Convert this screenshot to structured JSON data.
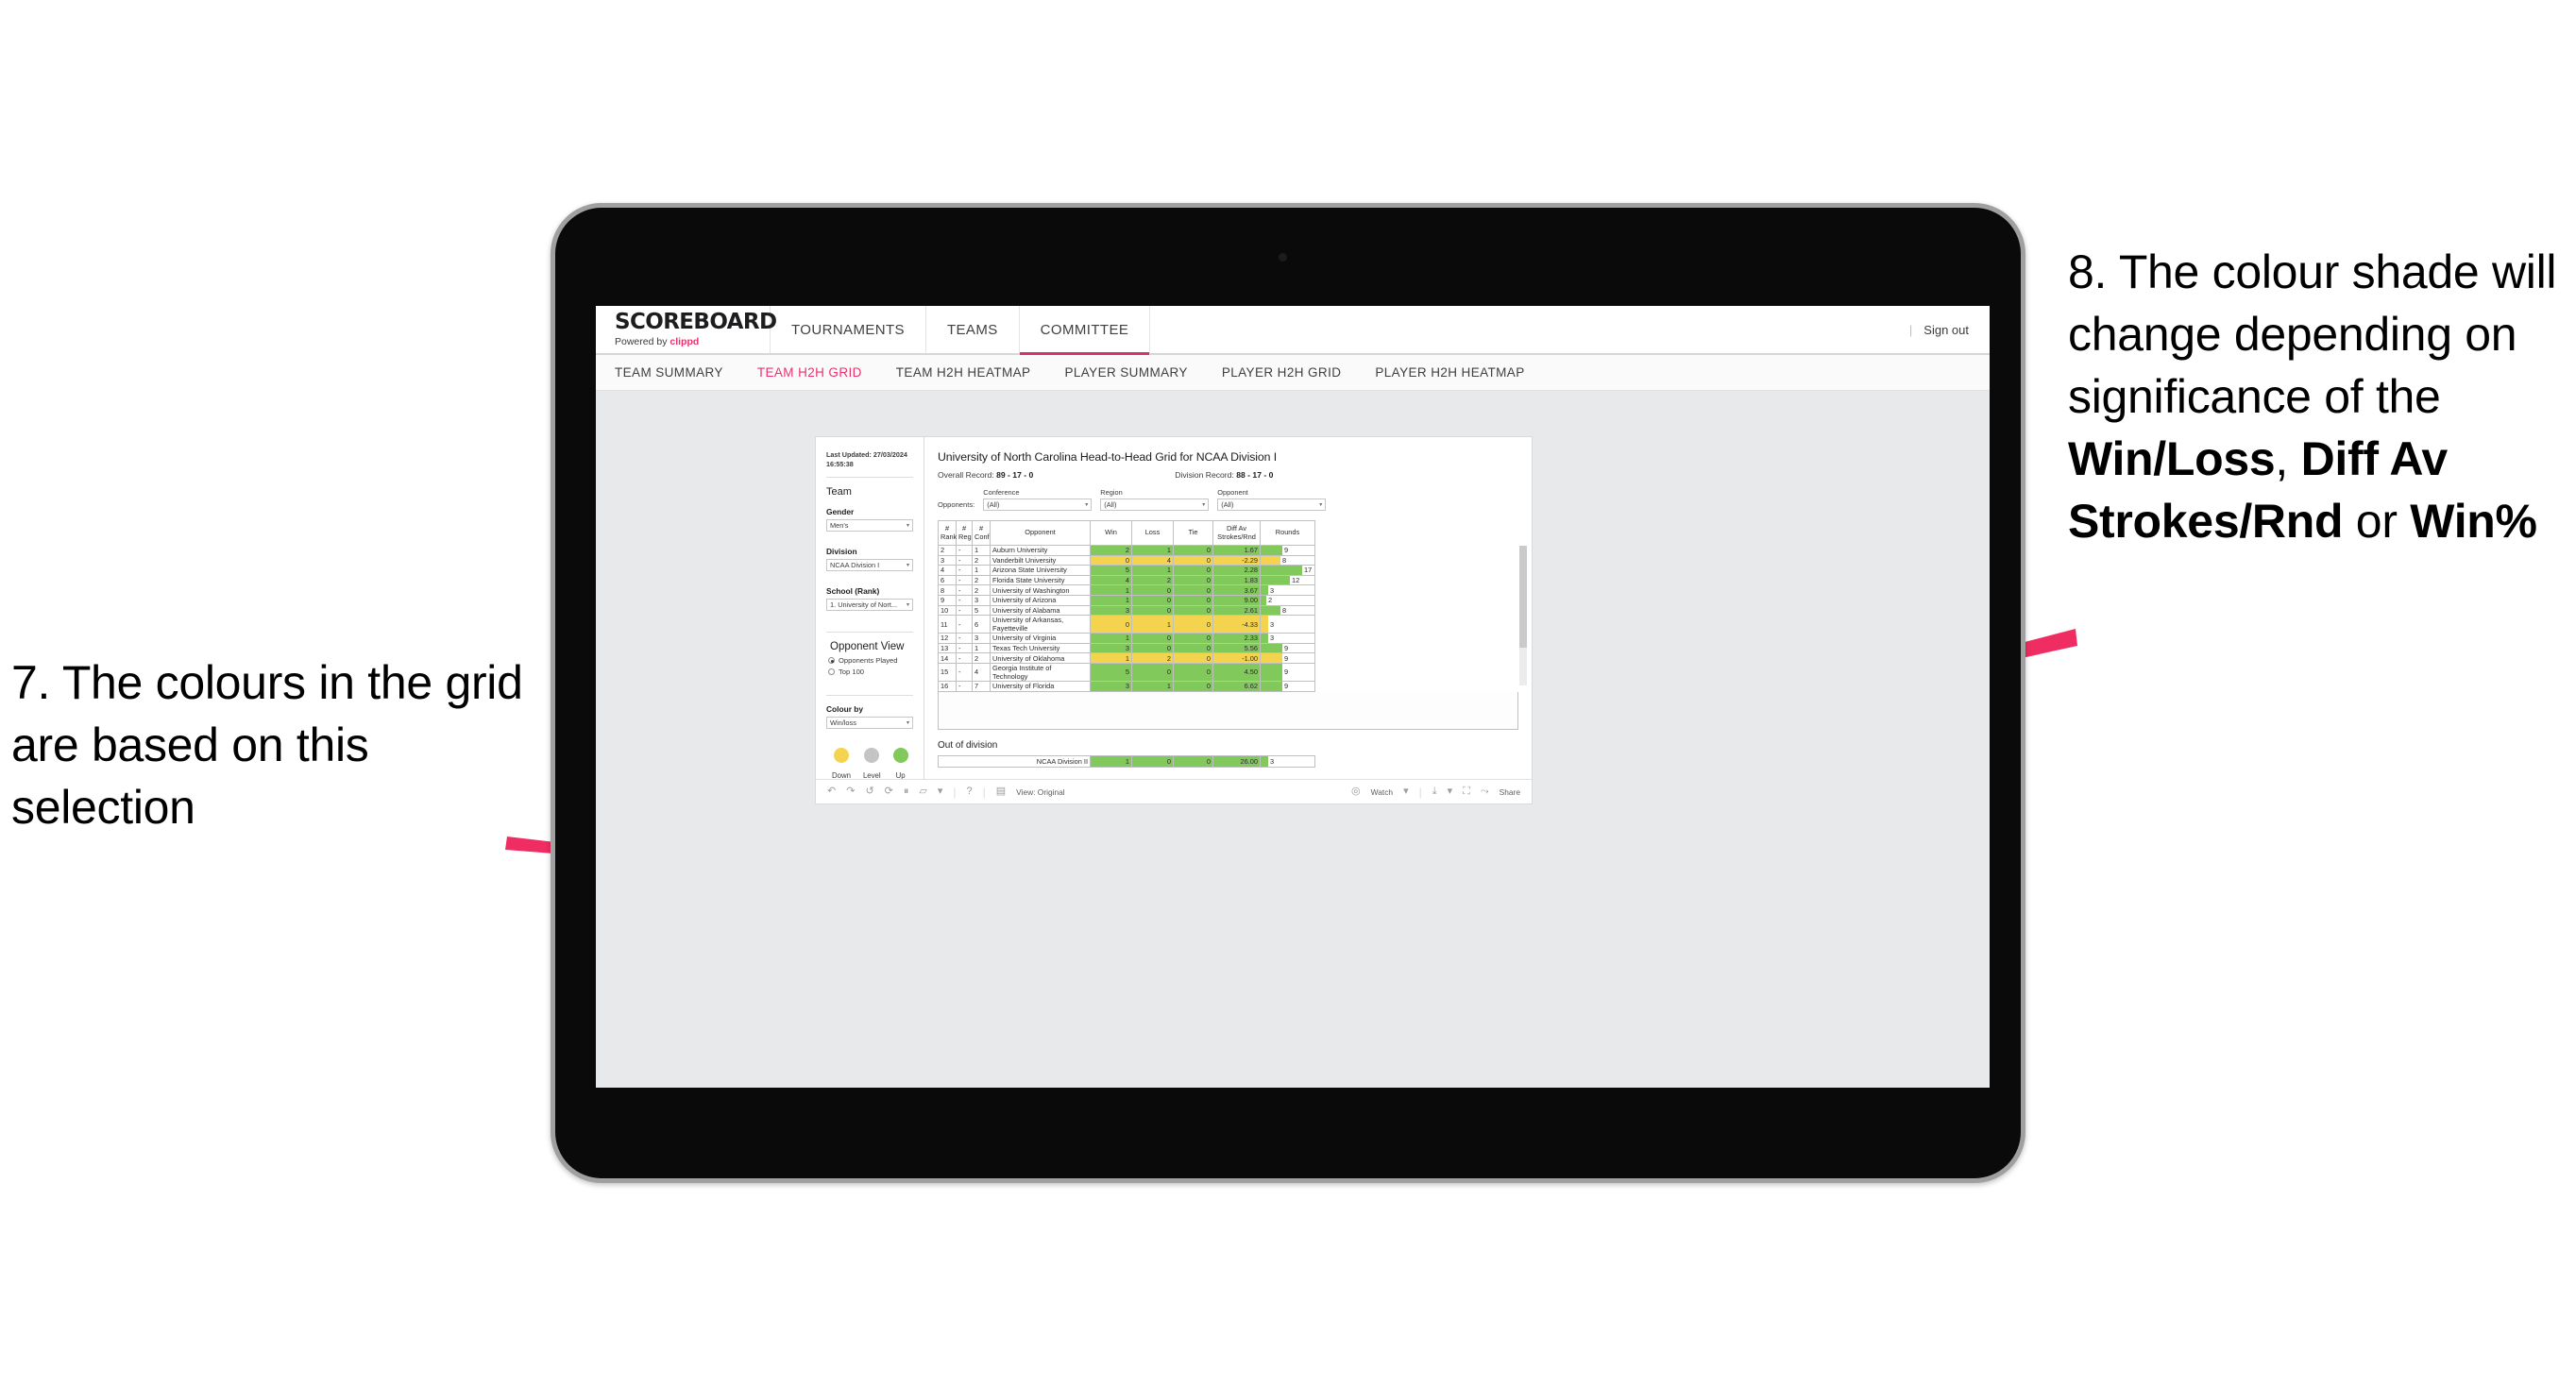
{
  "annotations": {
    "left": {
      "number": "7.",
      "text": "The colours in the grid are based on this selection"
    },
    "right": {
      "number": "8.",
      "part1": "The colour shade will change depending on significance of the ",
      "bold1": "Win/Loss",
      "mid1": ", ",
      "bold2": "Diff Av Strokes/Rnd",
      "mid2": " or ",
      "bold3": "Win%"
    },
    "arrow_color": "#f02d62"
  },
  "app": {
    "brand": {
      "logo": "SCOREBOARD",
      "powered_prefix": "Powered by ",
      "powered_brand": "clippd"
    },
    "topnav": [
      {
        "label": "TOURNAMENTS",
        "active": false
      },
      {
        "label": "TEAMS",
        "active": false
      },
      {
        "label": "COMMITTEE",
        "active": true
      }
    ],
    "account": {
      "divider": "|",
      "sign_out": "Sign out"
    },
    "subnav": [
      {
        "label": "TEAM SUMMARY",
        "active": false
      },
      {
        "label": "TEAM H2H GRID",
        "active": true
      },
      {
        "label": "TEAM H2H HEATMAP",
        "active": false
      },
      {
        "label": "PLAYER SUMMARY",
        "active": false
      },
      {
        "label": "PLAYER H2H GRID",
        "active": false
      },
      {
        "label": "PLAYER H2H HEATMAP",
        "active": false
      }
    ]
  },
  "pane": {
    "last_updated": "Last Updated: 27/03/2024 16:55:38",
    "team_heading": "Team",
    "gender_label": "Gender",
    "gender_value": "Men's",
    "division_label": "Division",
    "division_value": "NCAA Division I",
    "school_label": "School (Rank)",
    "school_value": "1. University of Nort...",
    "opponent_view_heading": "Opponent View",
    "opponent_view_options": [
      {
        "label": "Opponents Played",
        "selected": true
      },
      {
        "label": "Top 100",
        "selected": false
      }
    ],
    "colour_by_label": "Colour by",
    "colour_by_value": "Win/loss",
    "legend": [
      {
        "label": "Down",
        "color": "#f4d44e"
      },
      {
        "label": "Level",
        "color": "#c3c4c6"
      },
      {
        "label": "Up",
        "color": "#80c95a"
      }
    ]
  },
  "viz": {
    "title": "University of North Carolina Head-to-Head Grid for NCAA Division I",
    "overall_record_label": "Overall Record: ",
    "overall_record_value": "89 - 17 - 0",
    "division_record_label": "Division Record: ",
    "division_record_value": "88 - 17 - 0",
    "opponents_label": "Opponents:",
    "filters": [
      {
        "label": "Conference",
        "value": "(All)"
      },
      {
        "label": "Region",
        "value": "(All)"
      },
      {
        "label": "Opponent",
        "value": "(All)"
      }
    ],
    "columns": [
      "#\nRank",
      "#\nReg",
      "#\nConf",
      "Opponent",
      "Win",
      "Loss",
      "Tie",
      "Diff Av\nStrokes/Rnd",
      "Rounds"
    ],
    "out_of_division_title": "Out of division"
  },
  "chart_data": {
    "type": "table",
    "title": "University of North Carolina Head-to-Head Grid for NCAA Division I",
    "columns": [
      "# Rank",
      "# Reg",
      "# Conf",
      "Opponent",
      "Win",
      "Loss",
      "Tie",
      "Diff Av Strokes/Rnd",
      "Rounds"
    ],
    "colour_by": "Win/loss",
    "colour_scale": {
      "down": "#f4d44e",
      "level": "#c3c4c6",
      "up": "#80c95a"
    },
    "rounds_max": 17,
    "rows": [
      {
        "rank": "2",
        "reg": "-",
        "conf": "1",
        "opponent": "Auburn University",
        "win": "2",
        "loss": "1",
        "tie": "0",
        "diff": "1.67",
        "rounds": 9,
        "state": "up"
      },
      {
        "rank": "3",
        "reg": "-",
        "conf": "2",
        "opponent": "Vanderbilt University",
        "win": "0",
        "loss": "4",
        "tie": "0",
        "diff": "-2.29",
        "rounds": 8,
        "state": "down"
      },
      {
        "rank": "4",
        "reg": "-",
        "conf": "1",
        "opponent": "Arizona State University",
        "win": "5",
        "loss": "1",
        "tie": "0",
        "diff": "2.28",
        "rounds": 17,
        "state": "up"
      },
      {
        "rank": "6",
        "reg": "-",
        "conf": "2",
        "opponent": "Florida State University",
        "win": "4",
        "loss": "2",
        "tie": "0",
        "diff": "1.83",
        "rounds": 12,
        "state": "up"
      },
      {
        "rank": "8",
        "reg": "-",
        "conf": "2",
        "opponent": "University of Washington",
        "win": "1",
        "loss": "0",
        "tie": "0",
        "diff": "3.67",
        "rounds": 3,
        "state": "up"
      },
      {
        "rank": "9",
        "reg": "-",
        "conf": "3",
        "opponent": "University of Arizona",
        "win": "1",
        "loss": "0",
        "tie": "0",
        "diff": "9.00",
        "rounds": 2,
        "state": "up"
      },
      {
        "rank": "10",
        "reg": "-",
        "conf": "5",
        "opponent": "University of Alabama",
        "win": "3",
        "loss": "0",
        "tie": "0",
        "diff": "2.61",
        "rounds": 8,
        "state": "up"
      },
      {
        "rank": "11",
        "reg": "-",
        "conf": "6",
        "opponent": "University of Arkansas, Fayetteville",
        "win": "0",
        "loss": "1",
        "tie": "0",
        "diff": "-4.33",
        "rounds": 3,
        "state": "down"
      },
      {
        "rank": "12",
        "reg": "-",
        "conf": "3",
        "opponent": "University of Virginia",
        "win": "1",
        "loss": "0",
        "tie": "0",
        "diff": "2.33",
        "rounds": 3,
        "state": "up"
      },
      {
        "rank": "13",
        "reg": "-",
        "conf": "1",
        "opponent": "Texas Tech University",
        "win": "3",
        "loss": "0",
        "tie": "0",
        "diff": "5.56",
        "rounds": 9,
        "state": "up"
      },
      {
        "rank": "14",
        "reg": "-",
        "conf": "2",
        "opponent": "University of Oklahoma",
        "win": "1",
        "loss": "2",
        "tie": "0",
        "diff": "-1.00",
        "rounds": 9,
        "state": "down"
      },
      {
        "rank": "15",
        "reg": "-",
        "conf": "4",
        "opponent": "Georgia Institute of Technology",
        "win": "5",
        "loss": "0",
        "tie": "0",
        "diff": "4.50",
        "rounds": 9,
        "state": "up"
      },
      {
        "rank": "16",
        "reg": "-",
        "conf": "7",
        "opponent": "University of Florida",
        "win": "3",
        "loss": "1",
        "tie": "0",
        "diff": "6.62",
        "rounds": 9,
        "state": "up"
      }
    ],
    "out_of_division": [
      {
        "opponent": "NCAA Division II",
        "win": "1",
        "loss": "0",
        "tie": "0",
        "diff": "26.00",
        "rounds": 3,
        "state": "up"
      }
    ]
  },
  "toolbar": {
    "undo": "↶",
    "redo": "↷",
    "revert": "↺",
    "refresh": "⟳",
    "pause": "⏸",
    "share_alt": "▱",
    "caret": "▾",
    "sep": "|",
    "help": "?",
    "view_label": "View: Original",
    "watch_label": "Watch",
    "watch_caret": "▾",
    "download_caret": "▾",
    "share_label": "Share"
  }
}
